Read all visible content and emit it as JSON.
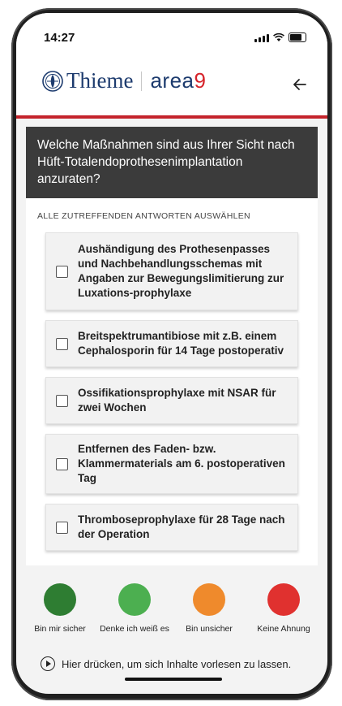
{
  "status_bar": {
    "time": "14:27"
  },
  "header": {
    "logo_brand": "Thieme",
    "logo_product_prefix": "area",
    "logo_product_suffix": "9",
    "back_icon": "arrow-left-icon"
  },
  "colors": {
    "accent_red": "#c4232b",
    "brand_blue": "#1d3b6e",
    "question_bg": "#3b3b3b"
  },
  "question": {
    "text": "Welche Maßnahmen sind aus Ihrer Sicht nach Hüft-Totalendoprothesenimplantation anzuraten?",
    "instruction": "ALLE ZUTREFFENDEN ANTWORTEN AUSWÄHLEN"
  },
  "options": [
    {
      "label": "Aushändigung des Prothesenpasses und Nachbehandlungsschemas mit Angaben zur Bewegungslimitierung zur Luxations-prophylaxe",
      "checked": false
    },
    {
      "label": "Breitspektrumantibiose mit z.B. einem Cephalosporin für 14 Tage postoperativ",
      "checked": false
    },
    {
      "label": "Ossifikationsprophylaxe mit NSAR für zwei Wochen",
      "checked": false
    },
    {
      "label": "Entfernen des Faden- bzw. Klammermaterials am 6. postoperativen Tag",
      "checked": false
    },
    {
      "label": "Thromboseprophylaxe für 28 Tage nach der Operation",
      "checked": false
    }
  ],
  "confidence": [
    {
      "label": "Bin mir sicher",
      "color": "#2e7d32"
    },
    {
      "label": "Denke ich weiß es",
      "color": "#4caf50"
    },
    {
      "label": "Bin unsicher",
      "color": "#ef8a2c"
    },
    {
      "label": "Keine Ahnung",
      "color": "#e0312f"
    }
  ],
  "read_aloud": {
    "label": "Hier drücken, um sich Inhalte vorlesen zu lassen.",
    "icon": "play-circle-icon"
  }
}
